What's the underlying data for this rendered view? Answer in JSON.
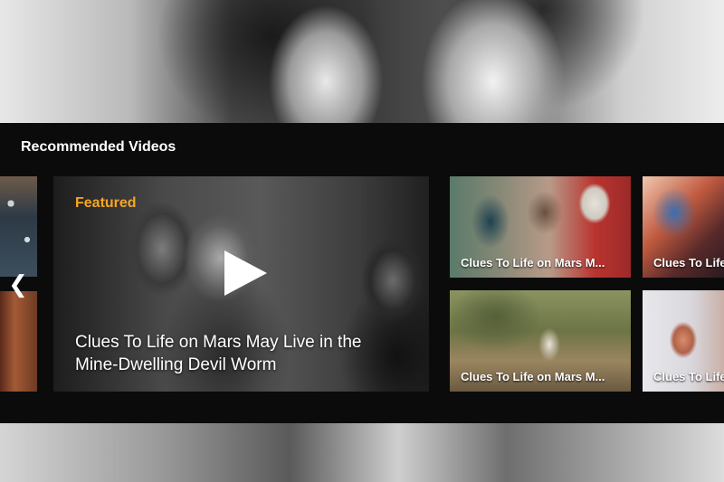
{
  "section": {
    "title": "Recommended Videos"
  },
  "featured": {
    "tag": "Featured",
    "title": "Clues To Life on Mars May Live in the Mine-Dwelling Devil Worm"
  },
  "grid": [
    {
      "label": "Clues To Life on Mars M..."
    },
    {
      "label": "Clues To Life on Mars M..."
    },
    {
      "label": "Clues To Life on Mars M..."
    },
    {
      "label": "Clues To Life on Mars M..."
    }
  ],
  "icons": {
    "prev": "chevron-left-icon",
    "play": "play-icon"
  },
  "colors": {
    "featured_tag": "#f5a623",
    "panel_bg": "#0b0b0c"
  }
}
